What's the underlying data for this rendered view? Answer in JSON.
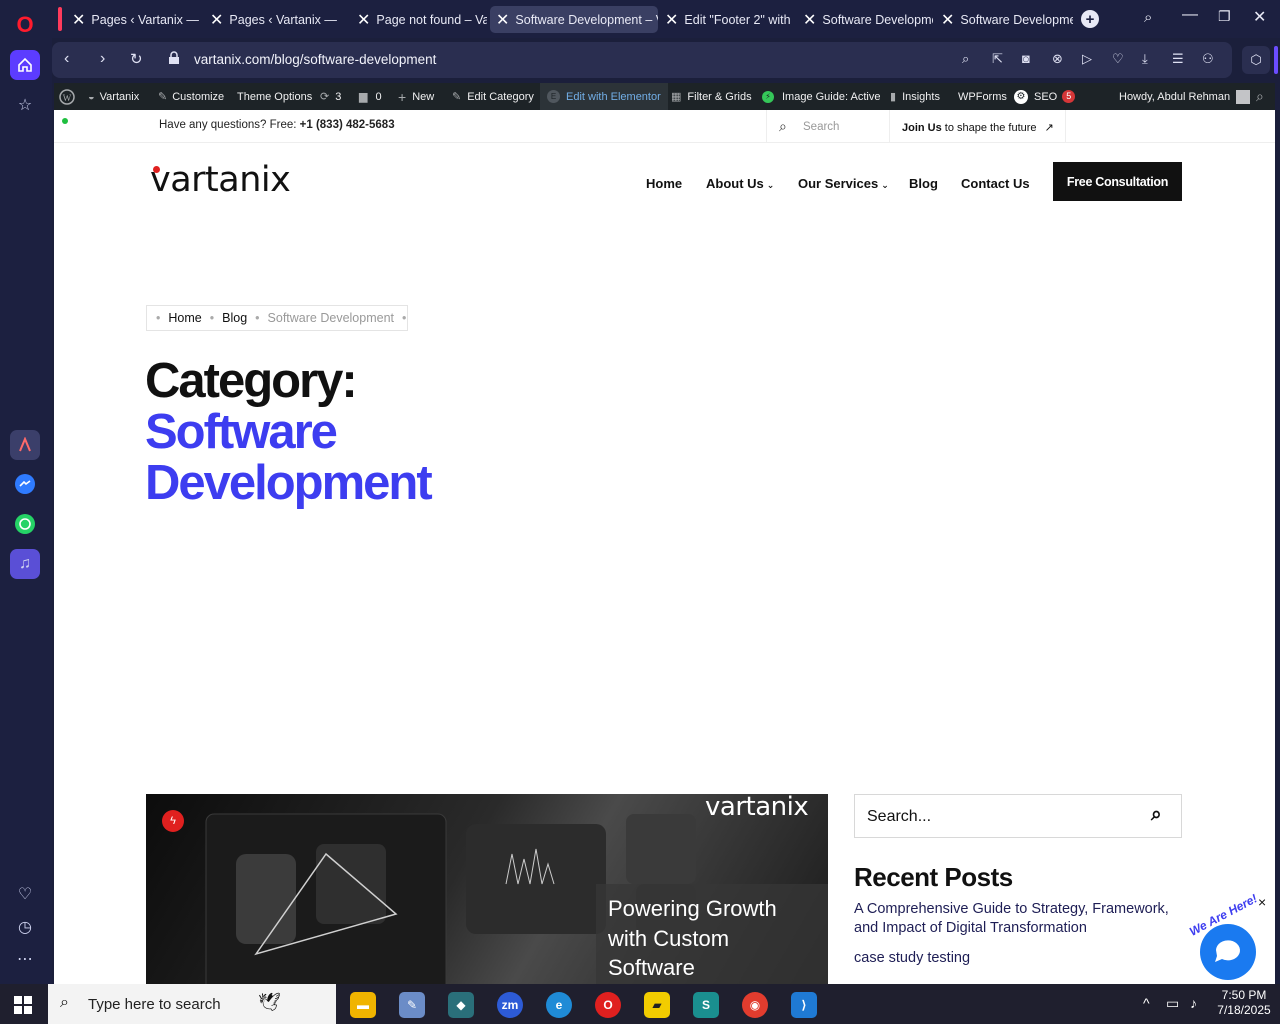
{
  "browser": {
    "tabs": [
      {
        "label": "Pages ‹ Vartanix — W"
      },
      {
        "label": "Pages ‹ Vartanix — W"
      },
      {
        "label": "Page not found – Va"
      },
      {
        "label": "Software Development – V"
      },
      {
        "label": "Edit \"Footer 2\" with I"
      },
      {
        "label": "Software Developme"
      },
      {
        "label": "Software Developme"
      }
    ],
    "new_tab": "+",
    "url": "vartanix.com/blog/software-development"
  },
  "wp_admin": {
    "site": "Vartanix",
    "customize": "Customize",
    "theme_options": "Theme Options",
    "updates": "3",
    "comments": "0",
    "new": "New",
    "edit_category": "Edit Category",
    "edit_elementor": "Edit with Elementor",
    "filter_grids": "Filter & Grids",
    "image_guide": "Image Guide: Active",
    "insights": "Insights",
    "wpforms": "WPForms",
    "seo": "SEO",
    "seo_count": "5",
    "howdy": "Howdy, Abdul Rehman"
  },
  "topbar": {
    "question": "Have any questions? Free: ",
    "phone": "+1 (833) 482-5683",
    "search_placeholder": "Search",
    "join_bold": "Join Us",
    "join_rest": " to shape the future",
    "join_arrow": "↗"
  },
  "header": {
    "logo": "vartanix",
    "nav": [
      "Home",
      "About Us",
      "Our Services",
      "Blog",
      "Contact Us"
    ],
    "cta": "Free Consultation"
  },
  "breadcrumb": [
    "Home",
    "Blog",
    "Software Development"
  ],
  "hero": {
    "prefix": "Category:",
    "line1": "Software",
    "line2": "Development"
  },
  "post": {
    "logo": "vartanix",
    "title": "Powering Growth with Custom Software"
  },
  "sidebar_widgets": {
    "search_placeholder": "Search...",
    "recent_title": "Recent Posts",
    "recent": [
      "A Comprehensive Guide to Strategy, Framework, and Impact of Digital Transformation",
      "case study testing"
    ]
  },
  "chat": {
    "badge": "We Are Here!",
    "close": "×"
  },
  "taskbar": {
    "search": "Type here to search",
    "time": "7:50 PM",
    "date": "7/18/2025"
  },
  "colors": {
    "accent": "#3d3df0",
    "dark": "#111111",
    "browser": "#1c2040"
  }
}
